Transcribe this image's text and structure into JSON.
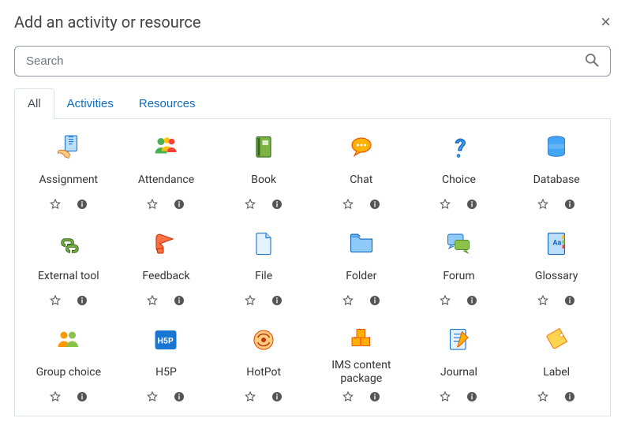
{
  "header": {
    "title": "Add an activity or resource"
  },
  "search": {
    "placeholder": "Search",
    "value": ""
  },
  "tabs": [
    {
      "id": "all",
      "label": "All",
      "active": true
    },
    {
      "id": "activities",
      "label": "Activities",
      "active": false
    },
    {
      "id": "resources",
      "label": "Resources",
      "active": false
    }
  ],
  "activities": [
    {
      "id": "assignment",
      "label": "Assignment",
      "icon": "assignment-icon"
    },
    {
      "id": "attendance",
      "label": "Attendance",
      "icon": "attendance-icon"
    },
    {
      "id": "book",
      "label": "Book",
      "icon": "book-icon"
    },
    {
      "id": "chat",
      "label": "Chat",
      "icon": "chat-icon"
    },
    {
      "id": "choice",
      "label": "Choice",
      "icon": "choice-icon"
    },
    {
      "id": "database",
      "label": "Database",
      "icon": "database-icon"
    },
    {
      "id": "external-tool",
      "label": "External tool",
      "icon": "external-tool-icon"
    },
    {
      "id": "feedback",
      "label": "Feedback",
      "icon": "feedback-icon"
    },
    {
      "id": "file",
      "label": "File",
      "icon": "file-icon"
    },
    {
      "id": "folder",
      "label": "Folder",
      "icon": "folder-icon"
    },
    {
      "id": "forum",
      "label": "Forum",
      "icon": "forum-icon"
    },
    {
      "id": "glossary",
      "label": "Glossary",
      "icon": "glossary-icon"
    },
    {
      "id": "group-choice",
      "label": "Group choice",
      "icon": "group-choice-icon"
    },
    {
      "id": "h5p",
      "label": "H5P",
      "icon": "h5p-icon"
    },
    {
      "id": "hotpot",
      "label": "HotPot",
      "icon": "hotpot-icon"
    },
    {
      "id": "ims-content",
      "label": "IMS content package",
      "icon": "ims-content-icon"
    },
    {
      "id": "journal",
      "label": "Journal",
      "icon": "journal-icon"
    },
    {
      "id": "label",
      "label": "Label",
      "icon": "label-icon"
    }
  ],
  "colors": {
    "link": "#0f6cbf",
    "border": "#dee2e6",
    "text": "#333333"
  }
}
